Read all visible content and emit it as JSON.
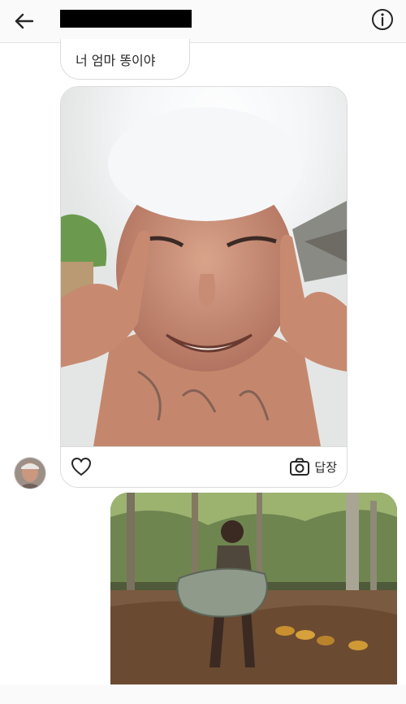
{
  "header": {
    "back_icon": "arrow-left-icon",
    "info_icon": "info-circle-icon",
    "username_redacted": true
  },
  "messages": {
    "received_text": "너 엄마 똥이야",
    "photo_card": {
      "like_icon": "heart-icon",
      "reply_icon": "camera-icon",
      "reply_label": "답장"
    }
  },
  "colors": {
    "background": "#ffffff",
    "header_bg": "#fafafa",
    "border": "#dbdbdb",
    "text": "#262626"
  }
}
